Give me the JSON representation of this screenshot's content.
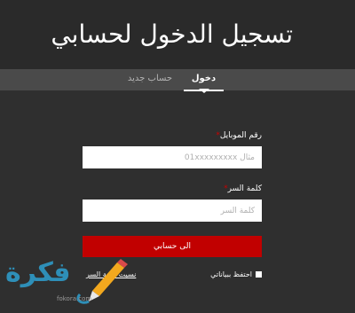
{
  "header": {
    "title": "تسجيل الدخول لحسابي"
  },
  "tabs": {
    "login": "دخول",
    "register": "حساب جديد"
  },
  "form": {
    "mobile_label": "رقم الموبايل",
    "mobile_placeholder": "مثال 01xxxxxxxxx",
    "password_label": "كلمة السر",
    "password_placeholder": "كلمة السر",
    "required_mark": "*",
    "submit_label": "الى حسابي",
    "remember_label": "احتفظ ببياناتي",
    "forgot_label": "نسيت كلمة السر"
  },
  "watermark": {
    "text": "فكرة",
    "url": "fokora.com"
  },
  "colors": {
    "background": "#2f2f2f",
    "tabbar": "#4a4a4a",
    "accent": "#c10000",
    "required": "#cc0000",
    "logo": "#2e8fb8"
  }
}
